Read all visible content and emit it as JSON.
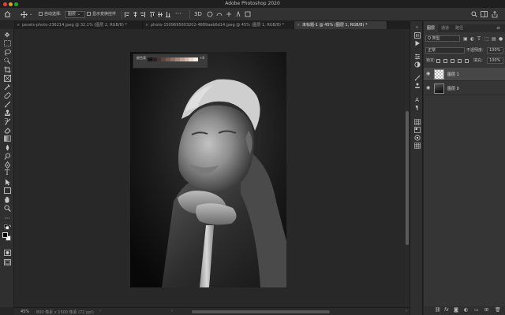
{
  "app": {
    "title": "Adobe Photoshop 2020"
  },
  "options_bar": {
    "auto_select_label": "自动选择:",
    "auto_select_value": "图层",
    "show_transform_label": "显示变换控件",
    "icons": [
      "home-icon",
      "move-tool-icon",
      "dropdown-icon",
      "align-icons",
      "3d-mode-icon",
      "search-icon",
      "workspace-icon",
      "share-icon"
    ]
  },
  "tabs": [
    {
      "label": "pexels-photo-236214.jpeg @ 32.1% (图层 2, RGB/8) *",
      "active": false
    },
    {
      "label": "photo-1509695603202-4889aab6d14.jpeg @ 45% (图层 1, RGB/8) *",
      "active": false
    },
    {
      "label": "未标题-1 @ 45% (图层 1, RGB/8) *",
      "active": true
    }
  ],
  "canvas": {
    "color_panel": {
      "label": "颜色表",
      "count": "+8",
      "swatches": [
        "#1a1414",
        "#2e2220",
        "#463330",
        "#5e4540",
        "#765a52",
        "#8e7066",
        "#a6877b",
        "#bea093",
        "#d5bbad",
        "#ead6cb",
        "#f6ece6"
      ]
    }
  },
  "status": {
    "zoom": "45%",
    "doc_info": "800 像素 x 1500 像素 (72 ppi)",
    "arrow": "›",
    "left_arrow": "‹",
    "right_arrow": "›"
  },
  "layers_panel": {
    "tabs": [
      "图层",
      "通道",
      "路径"
    ],
    "menu": "≡",
    "filter_label": "Q 类型",
    "blend_mode": "正常",
    "opacity_label": "不透明度:",
    "opacity_value": "100%",
    "lock_label": "锁定:",
    "fill_label": "填充:",
    "fill_value": "100%",
    "layers": [
      {
        "name": "图层 1",
        "visible": true,
        "selected": true,
        "thumb": "transparent"
      },
      {
        "name": "图层 0",
        "visible": true,
        "selected": false,
        "thumb": "portrait"
      }
    ],
    "footer_icons": [
      "link-icon",
      "fx-icon",
      "mask-icon",
      "adjustment-icon",
      "group-icon",
      "new-layer-icon",
      "trash-icon"
    ],
    "footer_fx": "fx"
  }
}
